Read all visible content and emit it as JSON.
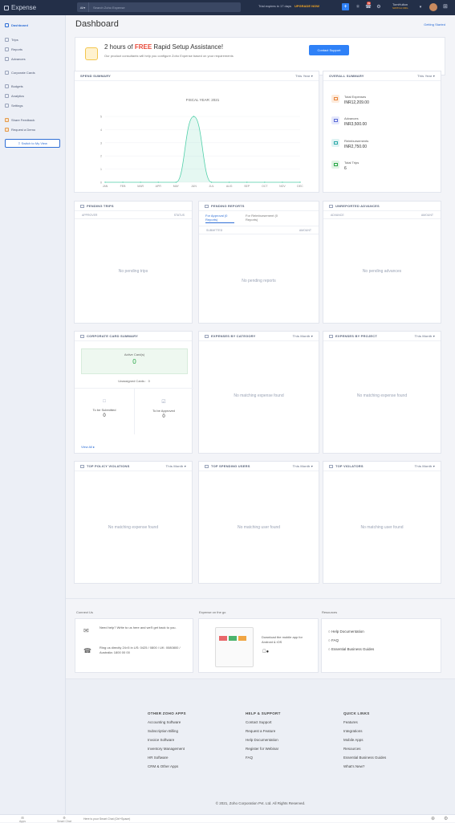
{
  "topbar": {
    "app_name": "Expense",
    "search_module": "All",
    "search_placeholder": "Search Zoho Expense",
    "trial_text": "Trial expires in 17 days",
    "upgrade_label": "UPGRADE NOW",
    "notif_count": "99",
    "org_name": "TomHulton",
    "switch_label": "SWITCH ORG"
  },
  "sidebar": {
    "items": [
      {
        "label": "Dashboard",
        "active": true
      },
      {
        "label": "Trips"
      },
      {
        "label": "Reports"
      },
      {
        "label": "Advances"
      },
      {
        "label": "Corporate Cards"
      },
      {
        "label": "Budgets"
      },
      {
        "label": "Analytics"
      },
      {
        "label": "Settings"
      },
      {
        "label": "Share Feedback"
      },
      {
        "label": "Request a Demo"
      }
    ],
    "switch_view_label": "Switch to My View"
  },
  "page": {
    "title": "Dashboard",
    "getting_started": "Getting Started"
  },
  "banner": {
    "title_pre": "2 hours of ",
    "title_free": "FREE",
    "title_post": " Rapid Setup Assistance!",
    "subtitle": "Our product consultants will help you configure Zoho Expense based on your requirements",
    "button": "Contact Support"
  },
  "spend_summary": {
    "title": "SPEND SUMMARY",
    "period": "This Year"
  },
  "overall_summary": {
    "title": "OVERALL SUMMARY",
    "period": "This Year",
    "items": [
      {
        "label": "Total Expenses",
        "value": "INR12,209.00",
        "color": "#e8833a"
      },
      {
        "label": "Advances",
        "value": "INR3,500.00",
        "color": "#5b6bd6"
      },
      {
        "label": "Reimbursements",
        "value": "INR2,750.00",
        "color": "#2aa8a8"
      },
      {
        "label": "Total Trips",
        "value": "6",
        "color": "#27a745"
      }
    ]
  },
  "chart_data": {
    "type": "area",
    "title": "FISCAL YEAR: 2021",
    "categories": [
      "JAN",
      "FEB",
      "MAR",
      "APR",
      "MAY",
      "JUN",
      "JUL",
      "AUG",
      "SEP",
      "OCT",
      "NOV",
      "DEC"
    ],
    "values": [
      0,
      0,
      0,
      0,
      0,
      5,
      0,
      0,
      0,
      0,
      0,
      0
    ],
    "ylim": [
      0,
      5
    ],
    "yticks": [
      "0",
      "1",
      "2",
      "3",
      "4",
      "5"
    ],
    "color": "#4fcfa8"
  },
  "pending_trips": {
    "title": "PENDING TRIPS",
    "col1": "APPROVER",
    "col2": "STATUS",
    "empty": "No pending trips"
  },
  "pending_reports": {
    "title": "PENDING REPORTS",
    "tab1": "For Approval (0 Reports)",
    "tab2": "For Reimbursement (0 Reports)",
    "col1": "SUBMITTED",
    "col2": "AMOUNT",
    "empty": "No pending reports"
  },
  "unreported_advances": {
    "title": "UNREPORTED ADVANCES",
    "col1": "ADVANCE",
    "col2": "AMOUNT",
    "empty": "No pending advances"
  },
  "corporate_card": {
    "title": "CORPORATE CARD SUMMARY",
    "active_label": "Active Card(s)",
    "active_value": "0",
    "unassigned_label": "Unassigned Cards :",
    "unassigned_value": "0",
    "to_submit_label": "To be Submitted",
    "to_submit_value": "0",
    "to_approve_label": "To be Approved",
    "to_approve_value": "0",
    "view_all": "View All ▸"
  },
  "expenses_by_category": {
    "title": "EXPENSES BY CATEGORY",
    "period": "This Month",
    "empty": "No matching expense found"
  },
  "expenses_by_project": {
    "title": "EXPENSES BY PROJECT",
    "period": "This Month",
    "empty": "No matching expense found"
  },
  "top_policy_violations": {
    "title": "TOP POLICY VIOLATIONS",
    "period": "This Month",
    "empty": "No matching expense found"
  },
  "top_spending_users": {
    "title": "TOP SPENDING USERS",
    "period": "This Month",
    "empty": "No matching user found"
  },
  "top_violators": {
    "title": "TOP VIOLATORS",
    "period": "This Month",
    "empty": "No matching user found"
  },
  "footer": {
    "connect_title": "Connect Us",
    "help_text": "Need help? Write to us here and we'll get back to you.",
    "call_text": "Ring us directly 24×5 in US: 0425 / 0800 / UK: 0080800 / Australia: 1800 00 00",
    "mobile_title": "Expense on the go",
    "mobile_text": "Download the mobile app for Android & iOS",
    "resources_title": "Resources",
    "resources": [
      "Help Documentation",
      "FAQ",
      "Essential Business Guides"
    ],
    "col1_title": "OTHER ZOHO APPS",
    "col1": [
      "Accounting Software",
      "Subscription Billing",
      "Invoice Software",
      "Inventory Management",
      "HR Software",
      "CRM & Other Apps"
    ],
    "col2_title": "HELP & SUPPORT",
    "col2": [
      "Contact Support",
      "Request a Feature",
      "Help Documentation",
      "Register for Webinar",
      "FAQ"
    ],
    "col3_title": "QUICK LINKS",
    "col3": [
      "Features",
      "Integrations",
      "Mobile Apps",
      "Resources",
      "Essential Business Guides",
      "What's New?"
    ],
    "copyright": "© 2021, Zoho Corporation Pvt. Ltd. All Rights Reserved."
  },
  "bottombar": {
    "apps": "Apps",
    "smart_chat": "Smart Chat",
    "placeholder": "Here is your Smart Chat (Ctrl+Space)"
  }
}
